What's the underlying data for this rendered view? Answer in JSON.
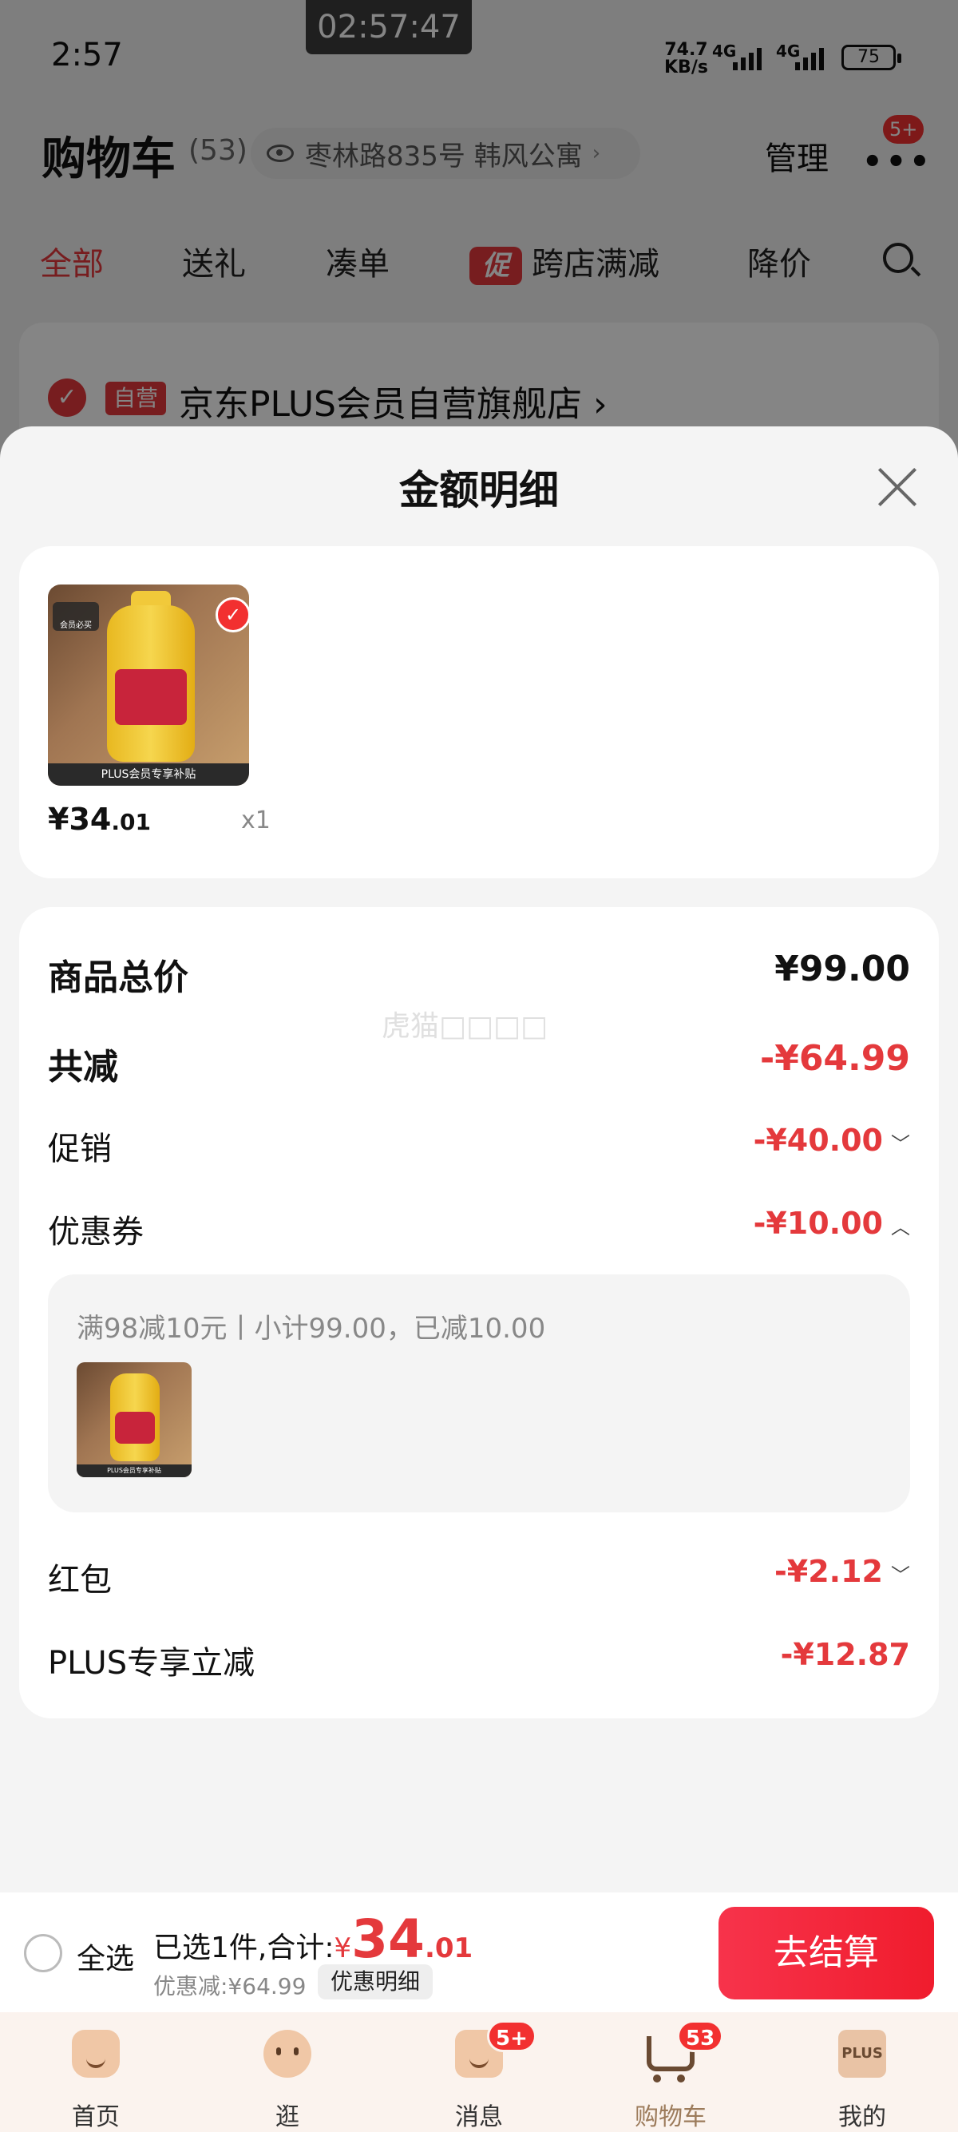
{
  "status_bar": {
    "time": "2:57",
    "recording_timer": "02:57:47",
    "net_speed_value": "74.7",
    "net_speed_unit": "KB/s",
    "sim1": "4G",
    "sim2": "4G",
    "battery": "75"
  },
  "cart_header": {
    "title": "购物车",
    "count": "(53)",
    "address": "枣林路835号 韩风公寓",
    "manage": "管理",
    "more_badge": "5+"
  },
  "filter_tabs": {
    "all": "全部",
    "gift": "送礼",
    "bundle": "凑单",
    "promo_tag": "促",
    "cross_store": "跨店满减",
    "price_drop": "降价"
  },
  "store": {
    "self_tag": "自营",
    "name": "京东PLUS会员自营旗舰店",
    "chevron": "›"
  },
  "sheet": {
    "title": "金额明细",
    "product": {
      "image_caption": "PLUS会员专享补贴",
      "image_badge": "会员必买",
      "price_symbol": "¥",
      "price_int": "34",
      "price_dec": ".01",
      "quantity": "x1"
    },
    "rows": {
      "total_label": "商品总价",
      "total_value": "¥99.00",
      "reduce_label": "共减",
      "reduce_value": "-¥64.99",
      "promo_label": "促销",
      "promo_value": "-¥40.00",
      "coupon_label": "优惠券",
      "coupon_value": "-¥10.00",
      "redpacket_label": "红包",
      "redpacket_value": "-¥2.12",
      "plus_label": "PLUS专享立减",
      "plus_value": "-¥12.87"
    },
    "watermark": "虎猫□□□□",
    "coupon_detail": {
      "text": "满98减10元丨小计99.00，已减10.00"
    }
  },
  "checkout": {
    "select_all": "全选",
    "summary_prefix": "已选1件,合计:",
    "total_symbol": "¥",
    "total_int": "34",
    "total_dec": ".01",
    "saved": "优惠减:¥64.99",
    "detail_button": "优惠明细",
    "pay_button": "去结算"
  },
  "navbar": {
    "home": "首页",
    "browse": "逛",
    "messages": "消息",
    "messages_badge": "5+",
    "cart": "购物车",
    "cart_badge": "53",
    "plus_icon_text": "PLUS",
    "mine": "我的"
  },
  "colors": {
    "accent": "#e4393c",
    "pay_button": "#f23030",
    "overlay": "#7d7d7d"
  }
}
